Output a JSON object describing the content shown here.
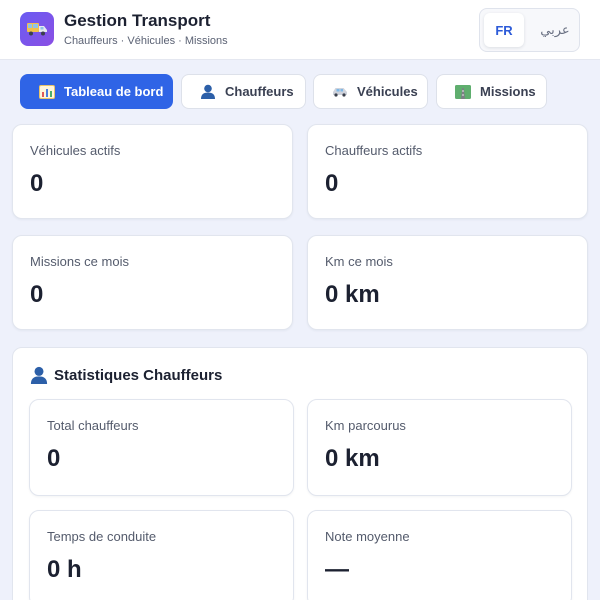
{
  "header": {
    "title": "Gestion Transport",
    "subtitle": "Chauffeurs · Véhicules · Missions",
    "logo_icon": "truck-icon",
    "lang": {
      "fr": "FR",
      "ar": "عربي",
      "active": "fr"
    }
  },
  "tabs": [
    {
      "label": "Tableau de bord",
      "icon": "bar-chart-icon",
      "active": true
    },
    {
      "label": "Chauffeurs",
      "icon": "user-icon",
      "active": false
    },
    {
      "label": "Véhicules",
      "icon": "car-icon",
      "active": false
    },
    {
      "label": "Missions",
      "icon": "route-icon",
      "active": false
    }
  ],
  "stats": [
    {
      "label": "Véhicules actifs",
      "value": "0"
    },
    {
      "label": "Chauffeurs actifs",
      "value": "0"
    },
    {
      "label": "Missions ce mois",
      "value": "0"
    },
    {
      "label": "Km ce mois",
      "value": "0 km"
    }
  ],
  "drivers_section": {
    "title": "Statistiques Chauffeurs",
    "icon": "user-icon",
    "stats": [
      {
        "label": "Total chauffeurs",
        "value": "0"
      },
      {
        "label": "Km parcourus",
        "value": "0 km"
      },
      {
        "label": "Temps de conduite",
        "value": "0 h"
      },
      {
        "label": "Note moyenne",
        "value": "—"
      }
    ]
  },
  "colors": {
    "accent": "#2f64e6",
    "background": "#eef1fb",
    "logo": "#6a5cf2"
  }
}
